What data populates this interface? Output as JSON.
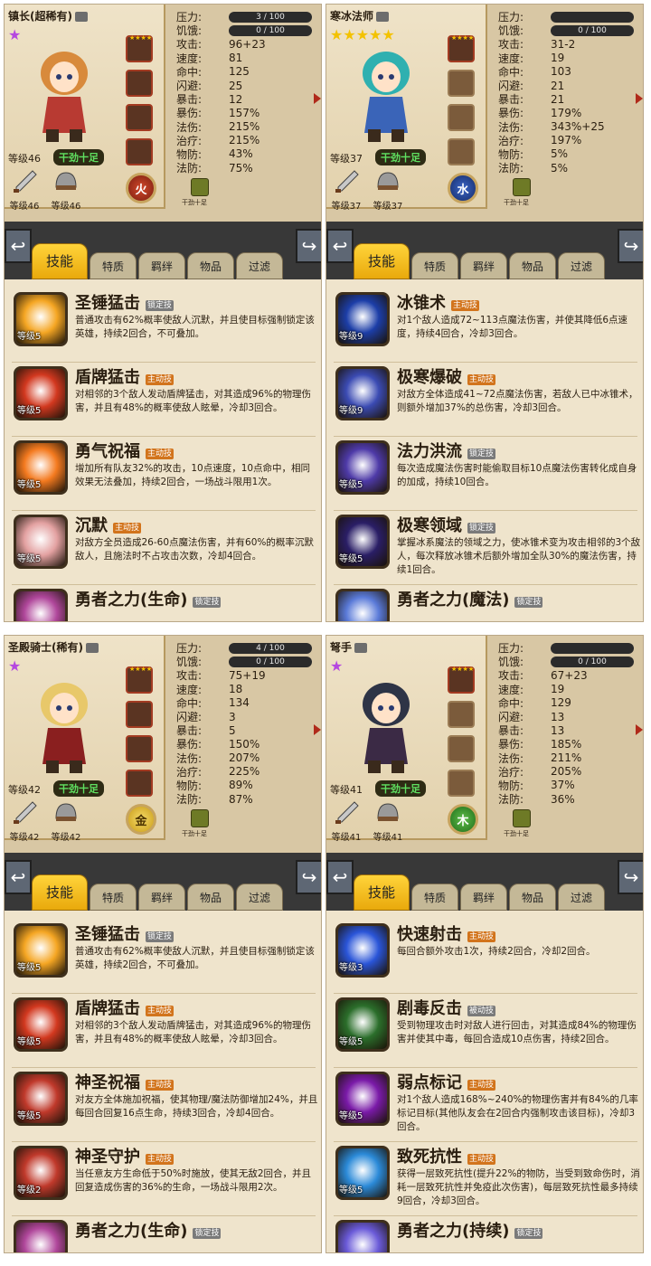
{
  "panels": [
    {
      "char_name": "镇长(超稀有)",
      "stars": "★",
      "level": "等级46",
      "motivation": "干劲十足",
      "gear": [
        "等级46",
        "等级46"
      ],
      "element": "火",
      "stats": {
        "pressure": "3 / 100",
        "hunger": "0 / 100",
        "attack": "96+23",
        "speed": "81",
        "hit": "125",
        "dodge": "25",
        "crit": "12",
        "crit_dmg": "157%",
        "magic": "215%",
        "heal": "215%",
        "defense": "43%",
        "m_defense": "75%"
      },
      "hunger_label": "干劲十足",
      "tabs": [
        "技能",
        "特质",
        "羁绊",
        "物品",
        "过滤"
      ],
      "skills": [
        {
          "name": "圣锤猛击",
          "type": "锁定技",
          "level": "等级5",
          "desc": "普通攻击有62%概率使敌人沉默，并且使目标强制锁定该英雄，持续2回合，不可叠加。"
        },
        {
          "name": "盾牌猛击",
          "type": "主动技",
          "level": "等级5",
          "desc": "对相邻的3个敌人发动盾牌猛击，对其造成96%的物理伤害，并且有48%的概率使敌人眩晕，冷却3回合。"
        },
        {
          "name": "勇气祝福",
          "type": "主动技",
          "level": "等级5",
          "desc": "增加所有队友32%的攻击，10点速度，10点命中，相同效果无法叠加，持续2回合，一场战斗限用1次。"
        },
        {
          "name": "沉默",
          "type": "主动技",
          "level": "等级5",
          "desc": "对敌方全员造成26-60点魔法伤害，并有60%的概率沉默敌人，且施法时不占攻击次数，冷却4回合。"
        },
        {
          "name": "勇者之力(生命)",
          "type": "锁定技",
          "level": "",
          "desc": ""
        }
      ]
    },
    {
      "char_name": "寒冰法师",
      "stars": "★★★★★",
      "level": "等级37",
      "motivation": "干劲十足",
      "gear": [
        "等级37",
        "等级37"
      ],
      "element": "水",
      "stats": {
        "pressure": "",
        "hunger": "0 / 100",
        "attack": "31-2",
        "speed": "19",
        "hit": "103",
        "dodge": "21",
        "crit": "21",
        "crit_dmg": "179%",
        "magic": "343%+25",
        "heal": "197%",
        "defense": "5%",
        "m_defense": "5%"
      },
      "hunger_label": "干劲十足",
      "tabs": [
        "技能",
        "特质",
        "羁绊",
        "物品",
        "过滤"
      ],
      "skills": [
        {
          "name": "冰锥术",
          "type": "主动技",
          "level": "等级9",
          "desc": "对1个敌人造成72~113点魔法伤害，并使其降低6点速度，持续4回合，冷却3回合。"
        },
        {
          "name": "极寒爆破",
          "type": "主动技",
          "level": "等级9",
          "desc": "对敌方全体造成41~72点魔法伤害，若敌人已中冰锥术，则额外增加37%的总伤害，冷却3回合。"
        },
        {
          "name": "法力洪流",
          "type": "锁定技",
          "level": "等级5",
          "desc": "每次造成魔法伤害时能偷取目标10点魔法伤害转化成自身的加成，持续10回合。"
        },
        {
          "name": "极寒领域",
          "type": "锁定技",
          "level": "等级5",
          "desc": "掌握冰系魔法的领域之力，使冰锥术变为攻击相邻的3个敌人，每次释放冰锥术后额外增加全队30%的魔法伤害，持续1回合。"
        },
        {
          "name": "勇者之力(魔法)",
          "type": "锁定技",
          "level": "",
          "desc": ""
        }
      ]
    },
    {
      "char_name": "圣殿骑士(稀有)",
      "stars": "★",
      "level": "等级42",
      "motivation": "干劲十足",
      "gear": [
        "等级42",
        "等级42"
      ],
      "element": "金",
      "stats": {
        "pressure": "4 / 100",
        "hunger": "0 / 100",
        "attack": "75+19",
        "speed": "18",
        "hit": "134",
        "dodge": "3",
        "crit": "5",
        "crit_dmg": "150%",
        "magic": "207%",
        "heal": "225%",
        "defense": "89%",
        "m_defense": "87%"
      },
      "hunger_label": "干劲十足",
      "tabs": [
        "技能",
        "特质",
        "羁绊",
        "物品",
        "过滤"
      ],
      "skills": [
        {
          "name": "圣锤猛击",
          "type": "锁定技",
          "level": "等级5",
          "desc": "普通攻击有62%概率使敌人沉默，并且使目标强制锁定该英雄，持续2回合，不可叠加。"
        },
        {
          "name": "盾牌猛击",
          "type": "主动技",
          "level": "等级5",
          "desc": "对相邻的3个敌人发动盾牌猛击，对其造成96%的物理伤害，并且有48%的概率使敌人眩晕，冷却3回合。"
        },
        {
          "name": "神圣祝福",
          "type": "主动技",
          "level": "等级5",
          "desc": "对友方全体施加祝福，使其物理/魔法防御增加24%，并且每回合回复16点生命，持续3回合，冷却4回合。"
        },
        {
          "name": "神圣守护",
          "type": "主动技",
          "level": "等级2",
          "desc": "当任意友方生命低于50%时施放，使其无敌2回合，并且回复造成伤害的36%的生命，一场战斗限用2次。"
        },
        {
          "name": "勇者之力(生命)",
          "type": "锁定技",
          "level": "",
          "desc": ""
        }
      ]
    },
    {
      "char_name": "弩手",
      "stars": "★",
      "level": "等级41",
      "motivation": "干劲十足",
      "gear": [
        "等级41",
        "等级41"
      ],
      "element": "木",
      "stats": {
        "pressure": "",
        "hunger": "0 / 100",
        "attack": "67+23",
        "speed": "19",
        "hit": "129",
        "dodge": "13",
        "crit": "13",
        "crit_dmg": "185%",
        "magic": "211%",
        "heal": "205%",
        "defense": "37%",
        "m_defense": "36%"
      },
      "hunger_label": "干劲十足",
      "tabs": [
        "技能",
        "特质",
        "羁绊",
        "物品",
        "过滤"
      ],
      "skills": [
        {
          "name": "快速射击",
          "type": "主动技",
          "level": "等级3",
          "desc": "每回合额外攻击1次，持续2回合，冷却2回合。"
        },
        {
          "name": "剧毒反击",
          "type": "被动技",
          "level": "等级5",
          "desc": "受到物理攻击时对敌人进行回击，对其造成84%的物理伤害并使其中毒，每回合造成10点伤害，持续2回合。"
        },
        {
          "name": "弱点标记",
          "type": "主动技",
          "level": "等级5",
          "desc": "对1个敌人造成168%~240%的物理伤害并有84%的几率标记目标(其他队友会在2回合内强制攻击该目标)，冷却3回合。"
        },
        {
          "name": "致死抗性",
          "type": "主动技",
          "level": "等级5",
          "desc": "获得一层致死抗性(提升22%的物防，当受到致命伤时，消耗一层致死抗性并免疫此次伤害)，每层致死抗性最多持续9回合，冷却3回合。"
        },
        {
          "name": "勇者之力(持续)",
          "type": "锁定技",
          "level": "",
          "desc": ""
        }
      ]
    }
  ],
  "stat_labels": {
    "pressure": "压力:",
    "hunger": "饥饿:",
    "attack": "攻击:",
    "speed": "速度:",
    "hit": "命中:",
    "dodge": "闪避:",
    "crit": "暴击:",
    "crit_dmg": "暴伤:",
    "magic": "法伤:",
    "heal": "治疗:",
    "defense": "物防:",
    "m_defense": "法防:"
  },
  "colors": {
    "tab_active": "#f2bd1f",
    "motivation_text": "#5fe060",
    "active_skill_badge": "#3c9b2a",
    "locked_skill_badge": "#7a7a7a"
  }
}
